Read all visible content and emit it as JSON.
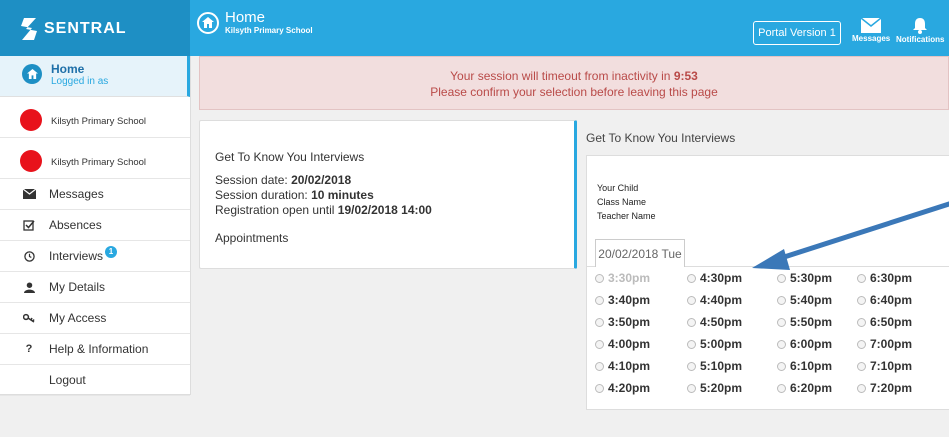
{
  "app": {
    "brand": "SENTRAL",
    "page_title": "Home",
    "school_subtitle": "Kilsyth Primary School",
    "portal_button": "Portal Version 1",
    "messages_label": "Messages",
    "notifications_label": "Notifications"
  },
  "sidebar": {
    "home_title": "Home",
    "home_sub": "Logged in as",
    "children": [
      {
        "label": "Kilsyth Primary School"
      },
      {
        "label": "Kilsyth Primary School"
      }
    ],
    "items": [
      {
        "label": "Messages",
        "icon": "envelope-icon"
      },
      {
        "label": "Absences",
        "icon": "checkbox-icon"
      },
      {
        "label": "Interviews",
        "icon": "clock-icon",
        "badge": "1"
      },
      {
        "label": "My Details",
        "icon": "user-icon"
      },
      {
        "label": "My Access",
        "icon": "key-icon"
      },
      {
        "label": "Help & Information",
        "icon": "question-icon"
      },
      {
        "label": "Logout",
        "icon": ""
      }
    ]
  },
  "timeout": {
    "line1_prefix": "Your session will timeout from inactivity in",
    "time": "9:53",
    "line2": "Please confirm your selection before leaving this page"
  },
  "interview_info": {
    "title": "Get To Know You Interviews",
    "date_label": "Session date:",
    "date_value": "20/02/2018",
    "duration_label": "Session duration:",
    "duration_value": "10 minutes",
    "registration_label": "Registration open until",
    "registration_value": "19/02/2018 14:00",
    "appointments": "Appointments"
  },
  "booking": {
    "heading": "Get To Know You Interviews",
    "labels": [
      "Your Child",
      "Class Name",
      "Teacher Name"
    ],
    "date_tab": "20/02/2018 Tue",
    "columns": [
      [
        "3:30pm",
        "3:40pm",
        "3:50pm",
        "4:00pm",
        "4:10pm",
        "4:20pm"
      ],
      [
        "4:30pm",
        "4:40pm",
        "4:50pm",
        "5:00pm",
        "5:10pm",
        "5:20pm"
      ],
      [
        "5:30pm",
        "5:40pm",
        "5:50pm",
        "6:00pm",
        "6:10pm",
        "6:20pm"
      ],
      [
        "6:30pm",
        "6:40pm",
        "6:50pm",
        "7:00pm",
        "7:10pm",
        "7:20pm"
      ]
    ],
    "disabled_slot": "3:30pm"
  },
  "colors": {
    "brand_blue": "#29a8e0",
    "alert_bg": "#f2dede",
    "alert_text": "#b94a48",
    "arrow": "#3b78b8"
  }
}
